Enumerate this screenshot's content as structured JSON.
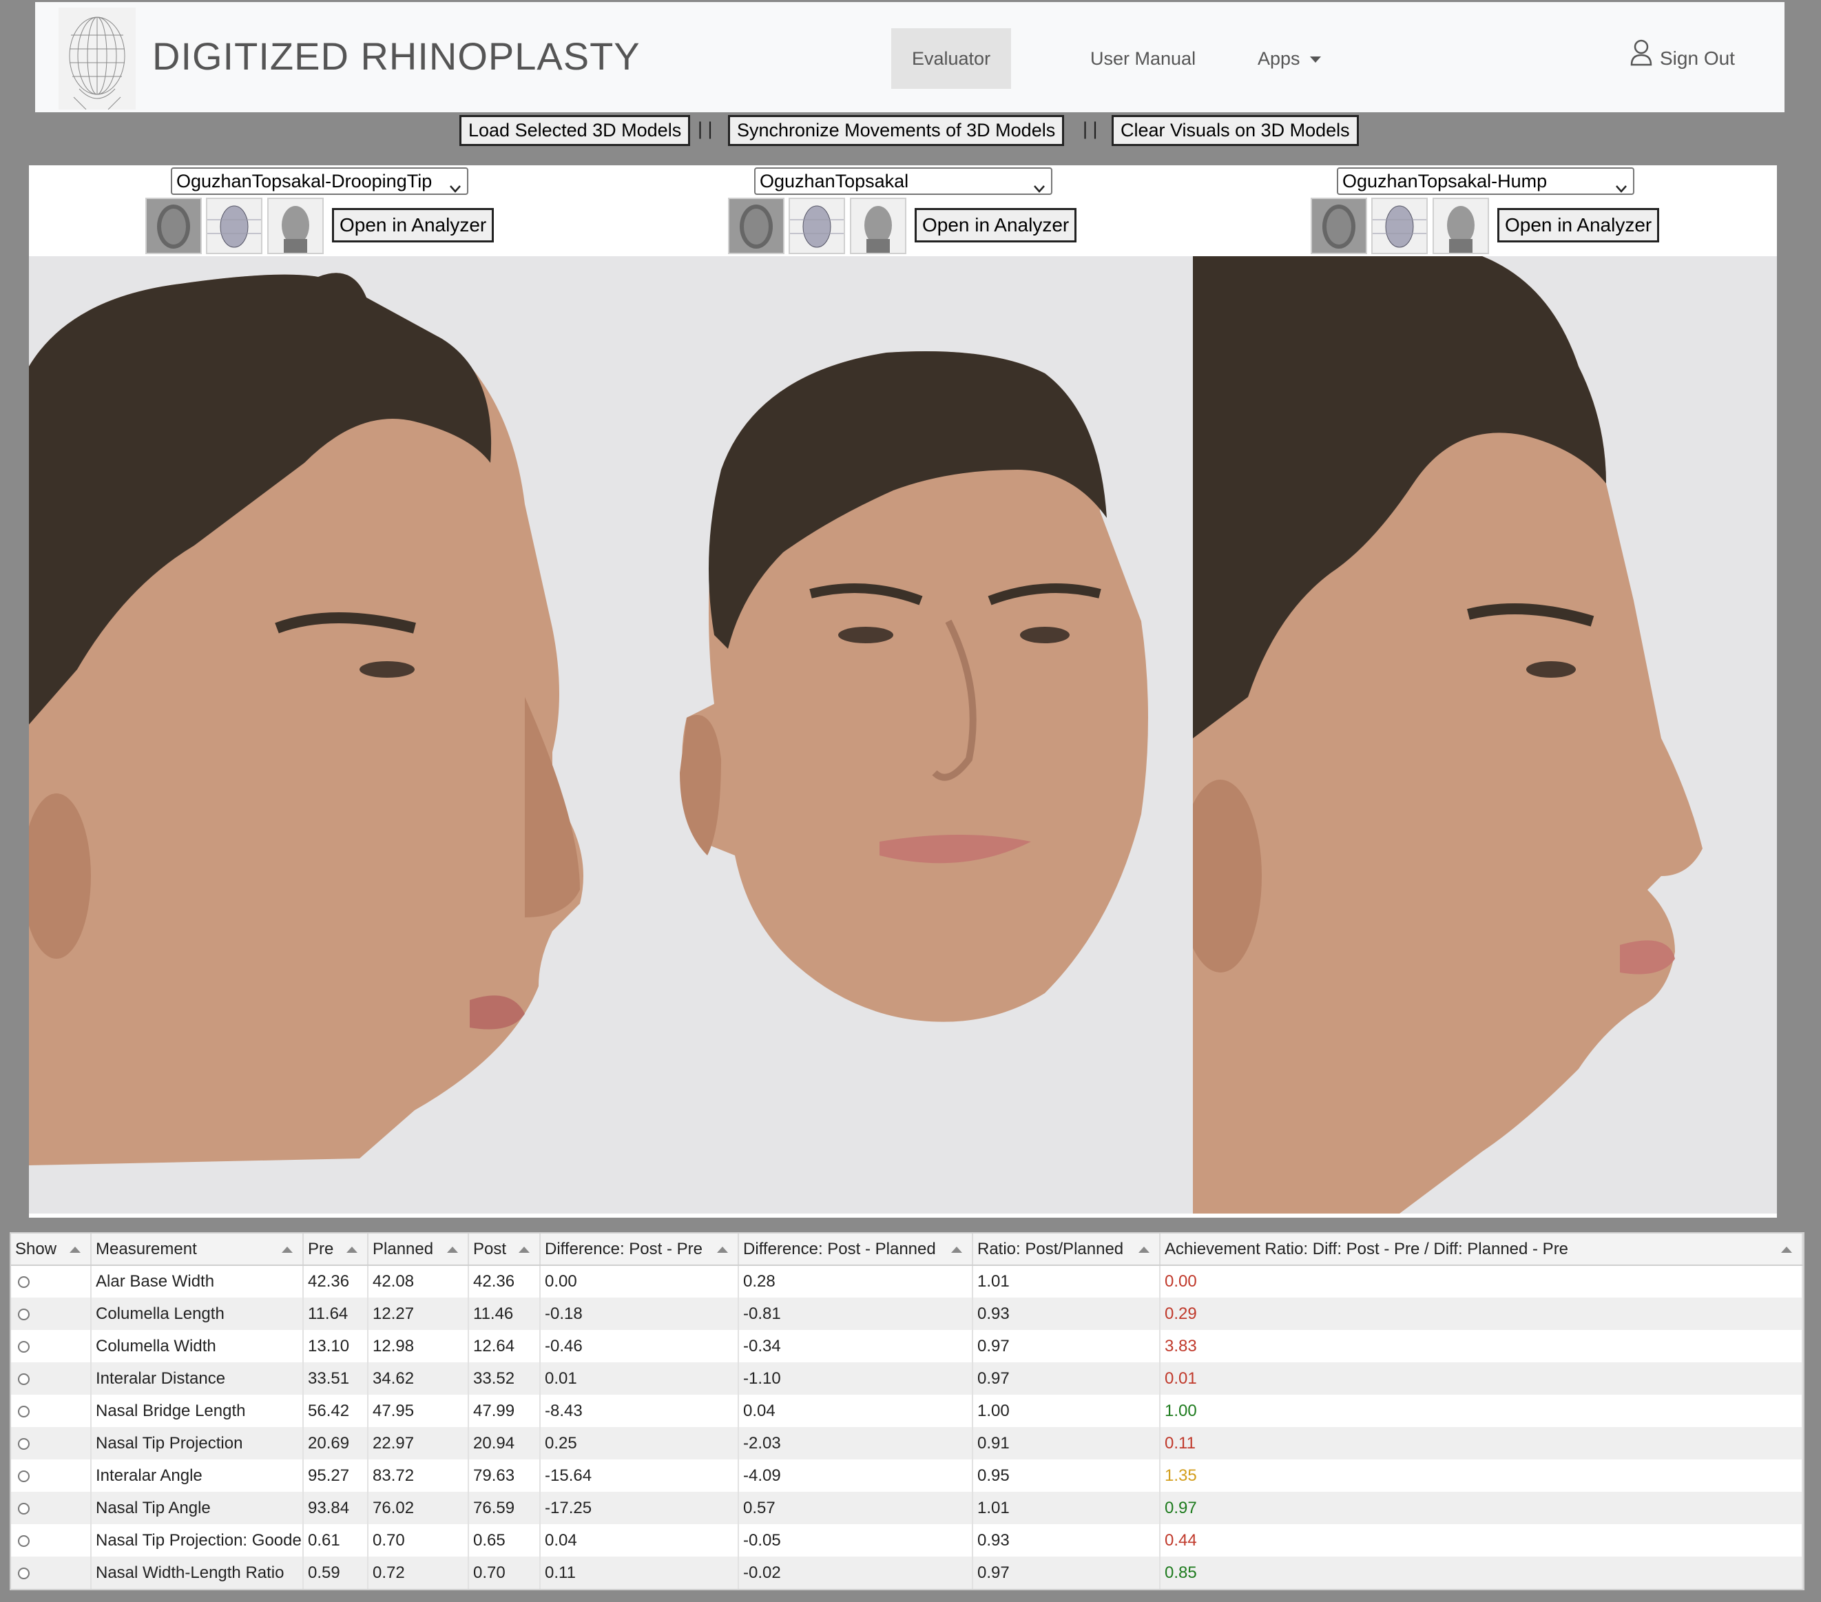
{
  "brand": "DIGITIZED RHINOPLASTY",
  "nav": {
    "evaluator": "Evaluator",
    "manual": "User Manual",
    "apps": "Apps",
    "signout": "Sign Out"
  },
  "toolbar": {
    "load": "Load Selected 3D Models",
    "sync": "Synchronize Movements of 3D Models",
    "clear": "Clear Visuals on 3D Models",
    "separator": "| |"
  },
  "viewers": [
    {
      "model": "OguzhanTopsakal-DroopingTip",
      "analyze": "Open in Analyzer"
    },
    {
      "model": "OguzhanTopsakal",
      "analyze": "Open in Analyzer"
    },
    {
      "model": "OguzhanTopsakal-Hump",
      "analyze": "Open in Analyzer"
    }
  ],
  "table": {
    "headers": [
      "Show",
      "Measurement",
      "Pre",
      "Planned",
      "Post",
      "Difference: Post - Pre",
      "Difference: Post - Planned",
      "Ratio: Post/Planned",
      "Achievement Ratio: Diff: Post - Pre / Diff: Planned - Pre"
    ],
    "rows": [
      {
        "m": "Alar Base Width",
        "pre": "42.36",
        "plan": "42.08",
        "post": "42.36",
        "d1": "0.00",
        "d2": "0.28",
        "r": "1.01",
        "a": "0.00",
        "color": "#c0392b"
      },
      {
        "m": "Columella Length",
        "pre": "11.64",
        "plan": "12.27",
        "post": "11.46",
        "d1": "-0.18",
        "d2": "-0.81",
        "r": "0.93",
        "a": "0.29",
        "color": "#c0392b"
      },
      {
        "m": "Columella Width",
        "pre": "13.10",
        "plan": "12.98",
        "post": "12.64",
        "d1": "-0.46",
        "d2": "-0.34",
        "r": "0.97",
        "a": "3.83",
        "color": "#c0392b"
      },
      {
        "m": "Interalar Distance",
        "pre": "33.51",
        "plan": "34.62",
        "post": "33.52",
        "d1": "0.01",
        "d2": "-1.10",
        "r": "0.97",
        "a": "0.01",
        "color": "#c0392b"
      },
      {
        "m": "Nasal Bridge Length",
        "pre": "56.42",
        "plan": "47.95",
        "post": "47.99",
        "d1": "-8.43",
        "d2": "0.04",
        "r": "1.00",
        "a": "1.00",
        "color": "#1e7b1e"
      },
      {
        "m": "Nasal Tip Projection",
        "pre": "20.69",
        "plan": "22.97",
        "post": "20.94",
        "d1": "0.25",
        "d2": "-2.03",
        "r": "0.91",
        "a": "0.11",
        "color": "#c0392b"
      },
      {
        "m": "Interalar Angle",
        "pre": "95.27",
        "plan": "83.72",
        "post": "79.63",
        "d1": "-15.64",
        "d2": "-4.09",
        "r": "0.95",
        "a": "1.35",
        "color": "#d39e1d"
      },
      {
        "m": "Nasal Tip Angle",
        "pre": "93.84",
        "plan": "76.02",
        "post": "76.59",
        "d1": "-17.25",
        "d2": "0.57",
        "r": "1.01",
        "a": "0.97",
        "color": "#1e7b1e"
      },
      {
        "m": "Nasal Tip Projection: Goode",
        "pre": "0.61",
        "plan": "0.70",
        "post": "0.65",
        "d1": "0.04",
        "d2": "-0.05",
        "r": "0.93",
        "a": "0.44",
        "color": "#c0392b"
      },
      {
        "m": "Nasal Width-Length Ratio",
        "pre": "0.59",
        "plan": "0.72",
        "post": "0.70",
        "d1": "0.11",
        "d2": "-0.02",
        "r": "0.97",
        "a": "0.85",
        "color": "#1e7b1e"
      }
    ]
  },
  "colors": {
    "red": "#c0392b",
    "green": "#1e7b1e",
    "amber": "#d39e1d",
    "skin": "#c99a7e",
    "hair": "#3b3128"
  }
}
